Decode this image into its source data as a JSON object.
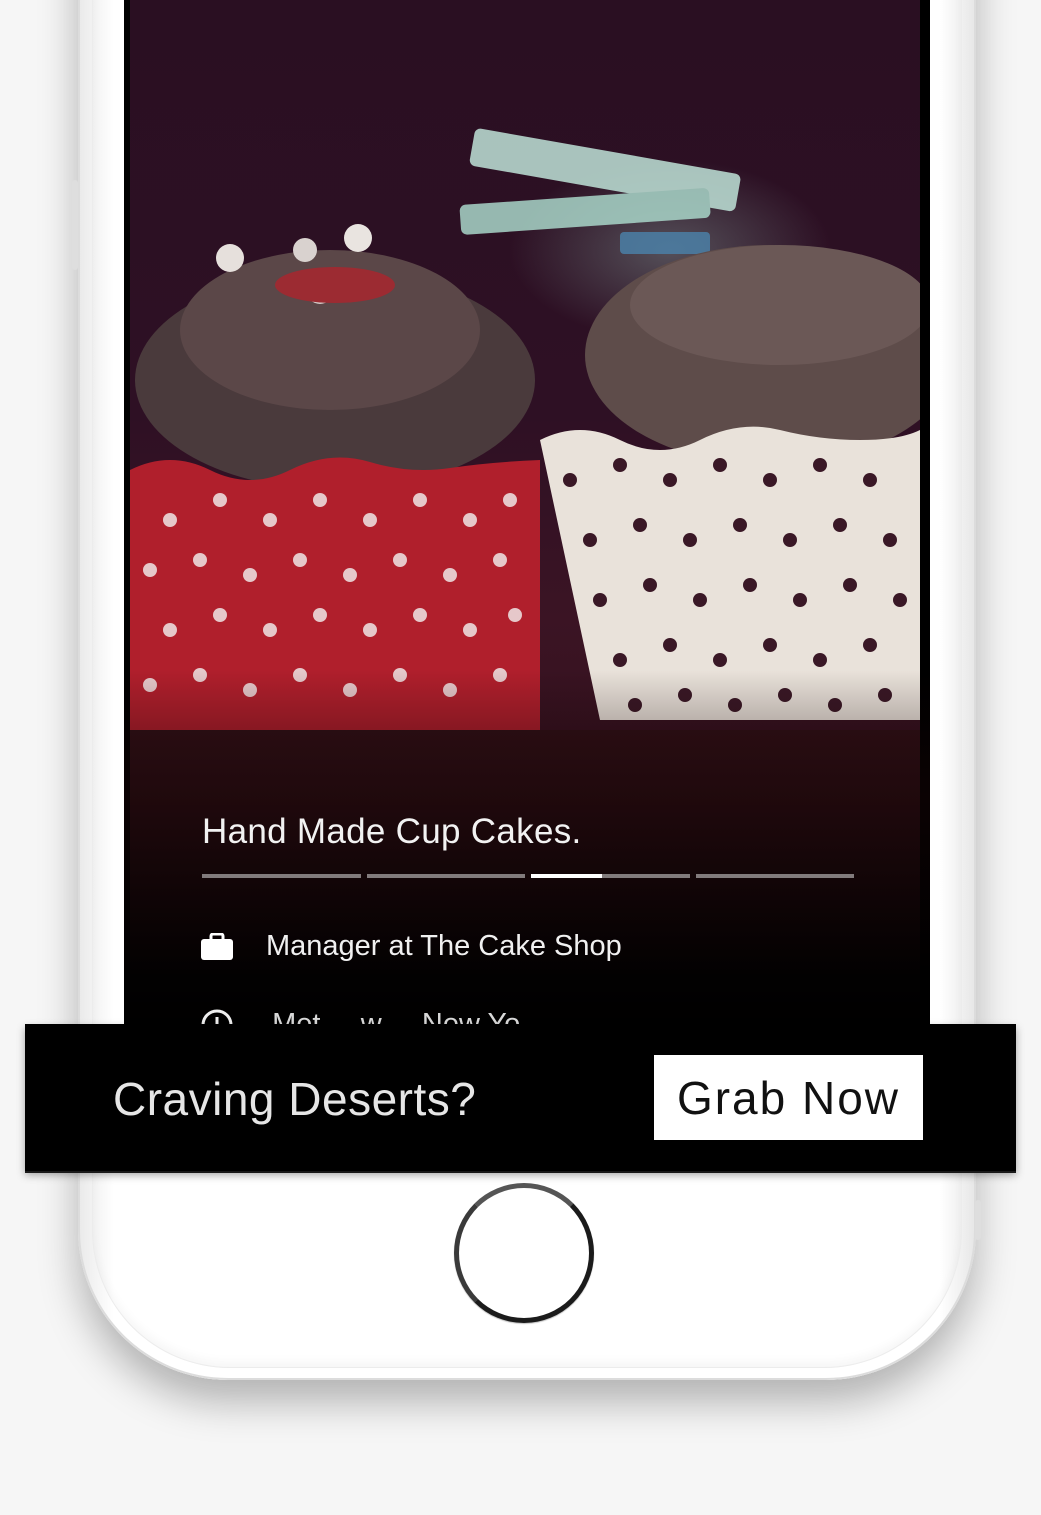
{
  "screen": {
    "image_alt": "Two chocolate cupcakes in polka-dot wrappers",
    "title": "Hand Made Cup Cakes.",
    "progress": {
      "segments": 4,
      "active_index": 2,
      "active_fill_fraction": 0.45
    },
    "job_line": "Manager at The Cake Shop",
    "cutoff_line": "Met ... w ... New Yo..."
  },
  "banner": {
    "text": "Craving Deserts?",
    "button_label": "Grab Now"
  },
  "icons": {
    "briefcase": "briefcase-icon",
    "clock": "clock-icon",
    "location": "location-pin-icon",
    "home": "home-button"
  },
  "colors": {
    "banner_bg": "#000000",
    "button_bg": "#ffffff",
    "text_light": "#f2f2f2"
  }
}
